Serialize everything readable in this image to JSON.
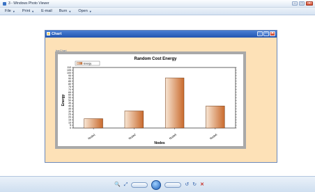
{
  "viewer": {
    "title": "3 - Windows Photo Viewer",
    "window_buttons": {
      "minimize": "–",
      "maximize": "□",
      "close": "✕"
    },
    "menu": [
      {
        "label": "File"
      },
      {
        "label": "Print"
      },
      {
        "label": "E-mail"
      },
      {
        "label": "Burn"
      },
      {
        "label": "Open"
      }
    ],
    "bottom_controls": {
      "zoom": "🔍",
      "previous": "◀◀",
      "play": "▶",
      "next": "▶▶",
      "rotate_left": "↺",
      "rotate_right": "↻",
      "delete": "✕"
    }
  },
  "chart_window": {
    "title": "Chart",
    "buttons": {
      "minimize": "_",
      "maximize": "□",
      "close": "✕"
    },
    "label": "barChart"
  },
  "colors": {
    "bar_light": "#f8e6d4",
    "bar_dark": "#c96a2d",
    "window_bg": "#fde1b7",
    "titlebar": "#2255b0"
  },
  "chart_data": {
    "type": "bar",
    "title": "Random Cost Energy",
    "xlabel": "Nodes",
    "ylabel": "Energy",
    "categories": [
      "Node1",
      "Node2",
      "Node5",
      "Node6"
    ],
    "series": [
      {
        "name": "Energy",
        "values": [
          17,
          31,
          91,
          40
        ]
      }
    ],
    "ylim": [
      0,
      110
    ],
    "yticks": [
      0,
      5,
      10,
      15,
      20,
      25,
      30,
      35,
      40,
      45,
      50,
      55,
      60,
      65,
      70,
      75,
      80,
      85,
      90,
      95,
      100,
      105,
      110
    ],
    "legend": "top-left",
    "grid": false
  }
}
